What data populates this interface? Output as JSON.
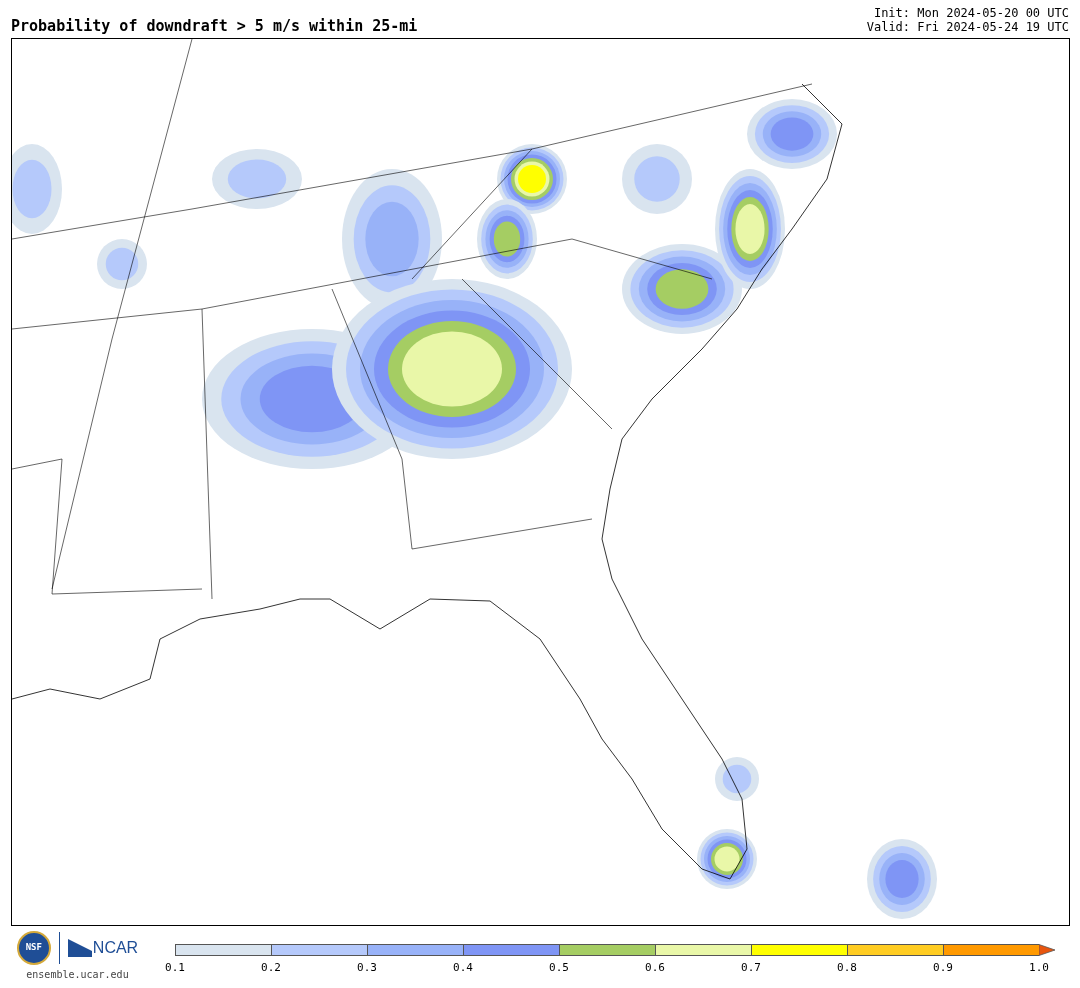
{
  "header": {
    "title": "Probability of downdraft > 5 m/s within 25-mi",
    "init": "Init: Mon 2024-05-20 00 UTC",
    "valid": "Valid: Fri 2024-05-24 19 UTC"
  },
  "footer": {
    "nsf_logo": "NSF",
    "ncar_logo": "NCAR",
    "site": "ensemble.ucar.edu"
  },
  "colorbar": {
    "segments": [
      {
        "kind": "bar",
        "color": "#d9e4ef"
      },
      {
        "kind": "bar",
        "color": "#b5c9fb"
      },
      {
        "kind": "bar",
        "color": "#98b2f8"
      },
      {
        "kind": "bar",
        "color": "#7f95f5"
      },
      {
        "kind": "bar",
        "color": "#a5cd63"
      },
      {
        "kind": "bar",
        "color": "#e9f7a8"
      },
      {
        "kind": "bar",
        "color": "#ffff00"
      },
      {
        "kind": "bar",
        "color": "#ffcc22"
      },
      {
        "kind": "bar",
        "color": "#ff9900"
      },
      {
        "kind": "arrow",
        "color": "#e8550e"
      }
    ],
    "ticks": [
      "0.1",
      "0.2",
      "0.3",
      "0.4",
      "0.5",
      "0.6",
      "0.7",
      "0.8",
      "0.9",
      "1.0"
    ]
  }
}
